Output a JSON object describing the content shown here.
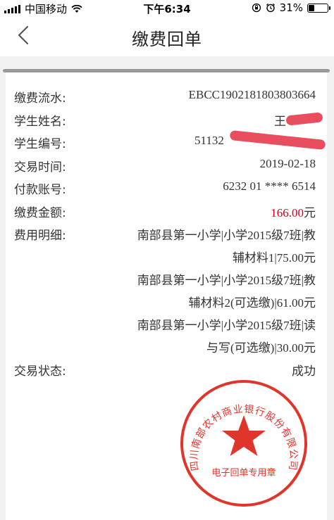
{
  "status": {
    "carrier": "中国移动",
    "time": "下午6:34",
    "battery": "31%"
  },
  "nav": {
    "title": "缴费回单"
  },
  "fields": {
    "serial": {
      "label": "缴费流水:",
      "value": "EBCC1902181803803664"
    },
    "name": {
      "label": "学生姓名:",
      "value": "王"
    },
    "id": {
      "label": "学生编号:",
      "value": "51132"
    },
    "time": {
      "label": "交易时间:",
      "value": "2019-02-18"
    },
    "account": {
      "label": "付款账号:",
      "value": "6232 01 **** 6514"
    },
    "amount": {
      "label": "缴费金额:",
      "value_number": "166.00",
      "value_unit": "元"
    },
    "details": {
      "label": "费用明细:",
      "lines": [
        "南部县第一小学|小学2015级7班|教",
        "辅材料1|75.00元",
        "南部县第一小学|小学2015级7班|教",
        "辅材料2(可选缴)|61.00元",
        "南部县第一小学|小学2015级7班|读",
        "与写(可选缴)|30.00元"
      ]
    },
    "status": {
      "label": "交易状态:",
      "value": "成功"
    }
  },
  "seal": {
    "text": "四川南部农村商业银行股份有限公司",
    "subtext": "电子回单专用章",
    "color": "#e0352b"
  },
  "colors": {
    "amount": "#d0021b",
    "redaction": "#e84555"
  },
  "icons": {
    "back": "chevron-left-icon",
    "wifi": "wifi-icon",
    "alarm": "alarm-icon",
    "lock": "orientation-lock-icon"
  }
}
